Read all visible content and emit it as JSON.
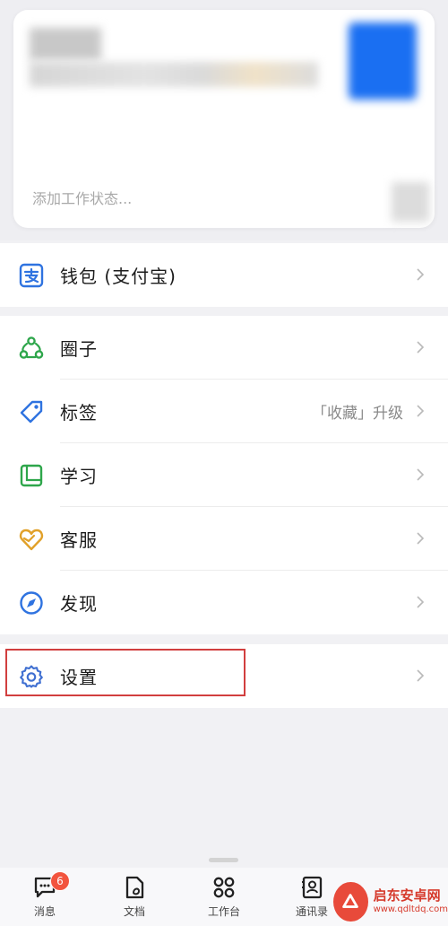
{
  "profile": {
    "status_placeholder": "添加工作状态..."
  },
  "wallet": {
    "label": "钱包 (支付宝)"
  },
  "menu": [
    {
      "label": "圈子",
      "icon": "circle-group-icon",
      "color": "#2ea64b"
    },
    {
      "label": "标签",
      "icon": "tag-icon",
      "color": "#2f73e0",
      "extra": "「收藏」升级"
    },
    {
      "label": "学习",
      "icon": "book-icon",
      "color": "#2ea64b"
    },
    {
      "label": "客服",
      "icon": "heart-icon",
      "color": "#e1a12a"
    },
    {
      "label": "发现",
      "icon": "compass-icon",
      "color": "#2f73e0"
    }
  ],
  "settings": {
    "label": "设置",
    "icon": "gear-icon",
    "color": "#3f6fd1"
  },
  "tabbar": {
    "tabs": [
      {
        "label": "消息",
        "icon": "chat-icon",
        "badge": "6"
      },
      {
        "label": "文档",
        "icon": "document-icon"
      },
      {
        "label": "工作台",
        "icon": "grid-icon"
      },
      {
        "label": "通讯录",
        "icon": "contacts-icon"
      }
    ]
  },
  "watermark": {
    "title": "启东安卓网",
    "url": "www.qdltdq.com"
  },
  "colors": {
    "accent": "#2f73e0",
    "badge": "#f2543e",
    "highlight": "#d13f3f"
  }
}
